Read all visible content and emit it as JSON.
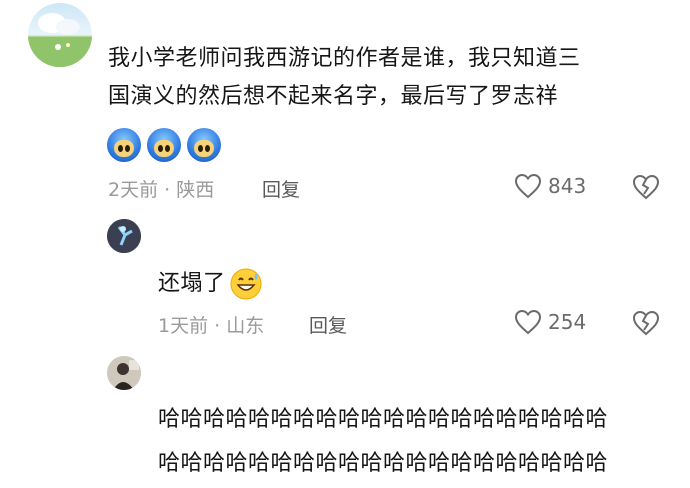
{
  "comment1": {
    "line1": "我小学老师问我西游记的作者是谁，我只知道三",
    "line2": "国演义的然后想不起来名字，最后写了罗志祥",
    "emoji_names": [
      "cool-doge-sticker",
      "cool-doge-sticker",
      "cool-doge-sticker"
    ],
    "meta": "2天前 · 陕西",
    "reply": "回复",
    "likes": "843"
  },
  "comment2": {
    "text": "还塌了",
    "emoji_name": "grinning-sweat-emoji",
    "meta": "1天前 · 山东",
    "reply": "回复",
    "likes": "254"
  },
  "comment3": {
    "line1": "哈哈哈哈哈哈哈哈哈哈哈哈哈哈哈哈哈哈哈哈",
    "line2": "哈哈哈哈哈哈哈哈哈哈哈哈哈哈哈哈哈哈哈哈"
  },
  "colors": {
    "meta": "#9a9a9a",
    "text": "#161616"
  }
}
